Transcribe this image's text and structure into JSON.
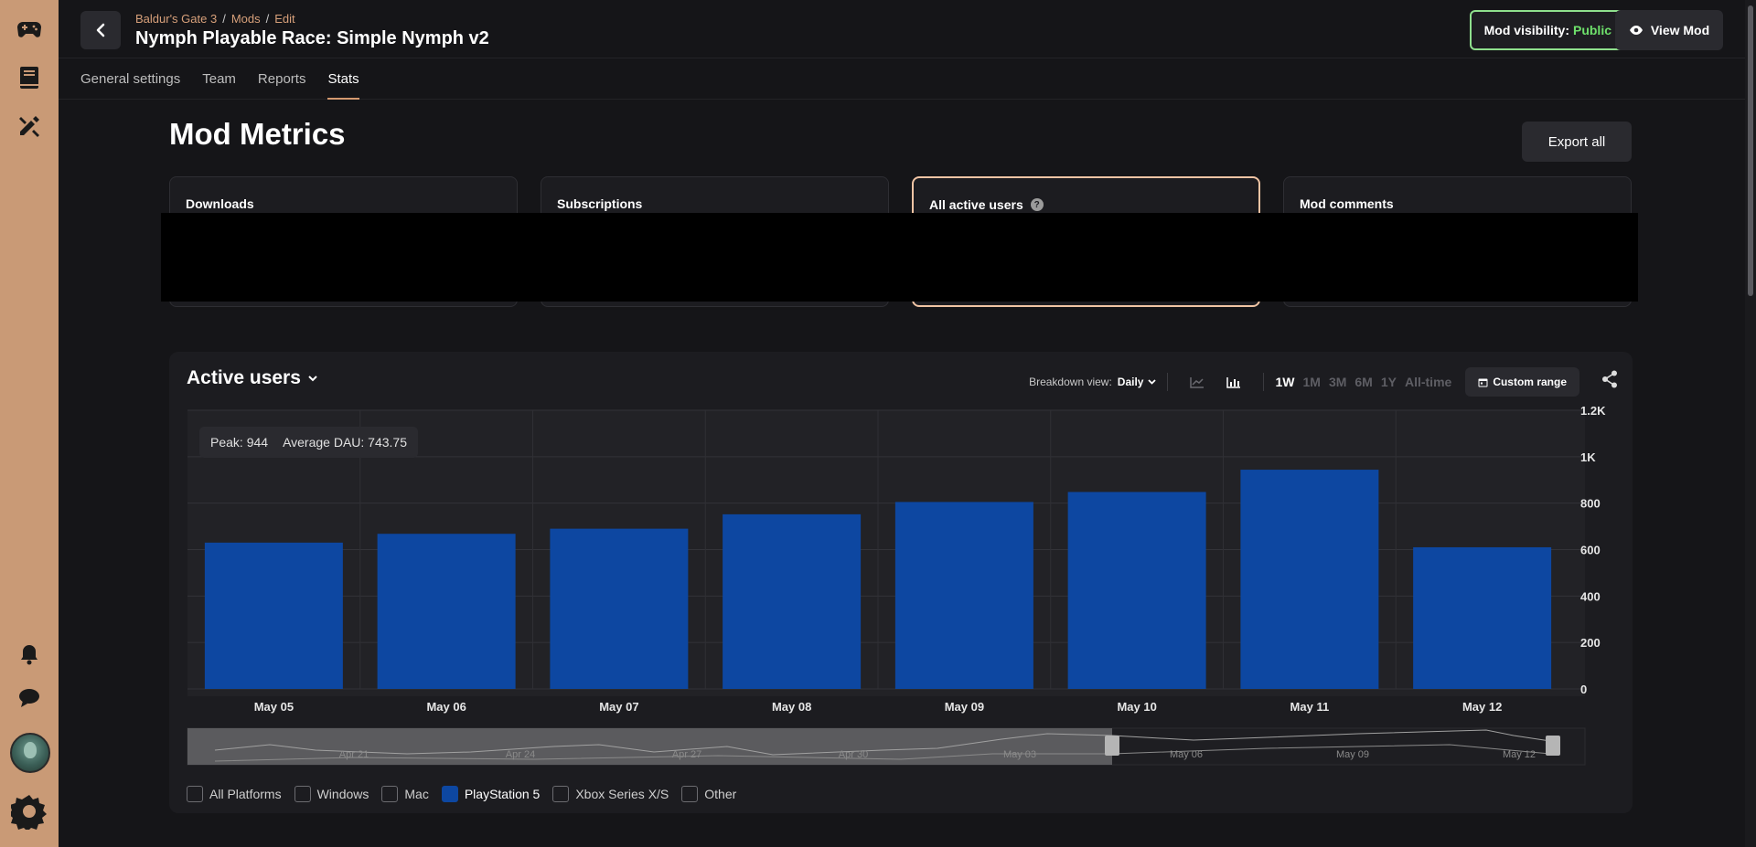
{
  "breadcrumb": [
    "Baldur's Gate 3",
    "Mods",
    "Edit"
  ],
  "mod_title": "Nymph Playable Race: Simple Nymph v2",
  "visibility": {
    "label": "Mod visibility:",
    "value": "Public"
  },
  "view_mod_label": "View Mod",
  "tabs": [
    "General settings",
    "Team",
    "Reports",
    "Stats"
  ],
  "active_tab": "Stats",
  "page_title": "Mod Metrics",
  "export_label": "Export all",
  "metrics": [
    "Downloads",
    "Subscriptions",
    "All active users",
    "Mod comments"
  ],
  "panel": {
    "title": "Active users",
    "breakdown_label": "Breakdown view:",
    "breakdown_value": "Daily",
    "ranges": [
      "1W",
      "1M",
      "3M",
      "6M",
      "1Y",
      "All-time"
    ],
    "active_range": "1W",
    "custom_range_label": "Custom range",
    "tooltip": {
      "peak": "Peak: 944",
      "average": "Average DAU: 743.75"
    }
  },
  "legend": [
    {
      "label": "All Platforms",
      "checked": false
    },
    {
      "label": "Windows",
      "checked": false
    },
    {
      "label": "Mac",
      "checked": false
    },
    {
      "label": "PlayStation 5",
      "checked": true
    },
    {
      "label": "Xbox Series X/S",
      "checked": false
    },
    {
      "label": "Other",
      "checked": false
    }
  ],
  "chart_data": {
    "type": "bar",
    "categories": [
      "May 05",
      "May 06",
      "May 07",
      "May 08",
      "May 09",
      "May 10",
      "May 11",
      "May 12"
    ],
    "series": [
      {
        "name": "PlayStation 5",
        "values": [
          630,
          668,
          690,
          752,
          805,
          848,
          944,
          610
        ]
      }
    ],
    "y_ticks": [
      "0",
      "200",
      "400",
      "600",
      "800",
      "1K",
      "1.2K"
    ],
    "ylim": [
      0,
      1200
    ],
    "bar_color": "#0d47a1",
    "grid": true,
    "navigator": {
      "ticks": [
        "Apr 21",
        "Apr 24",
        "Apr 27",
        "Apr 30",
        "May 03",
        "May 06",
        "May 09",
        "May 12"
      ],
      "selected_from": "May 05"
    }
  },
  "colors": {
    "accent": "#c99a76",
    "public": "#6ee06b",
    "bar": "#0d47a1"
  }
}
